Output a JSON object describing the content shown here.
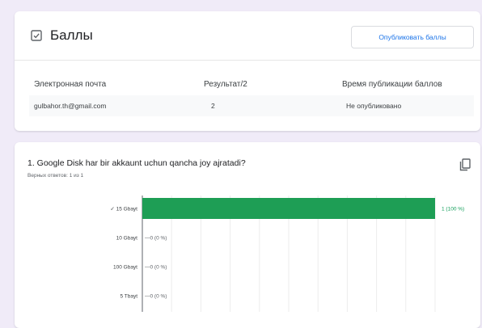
{
  "scores_card": {
    "title": "Баллы",
    "icon": "checkbox-icon",
    "publish_button": "Опубликовать баллы",
    "columns": [
      "Электронная почта",
      "Результат/2",
      "Время публикации баллов"
    ],
    "rows": [
      {
        "email": "gulbahor.th@gmail.com",
        "score": "2",
        "published": "Не опубликовано"
      }
    ]
  },
  "question_card": {
    "title": "1. Google Disk har bir akkaunt uchun qancha joy ajratadi?",
    "correct_count": "Верных ответов: 1 из 1",
    "copy_icon": "copy-icon"
  },
  "colors": {
    "accent_blue": "#1a73e8",
    "bar_green": "#1e9e55",
    "background": "#f0ebf8"
  },
  "chart_data": {
    "type": "bar",
    "orientation": "horizontal",
    "categories": [
      "✓ 15 Gbayt",
      "10 Gbayt",
      "100 Gbayt",
      "5 Tbayt"
    ],
    "values": [
      1,
      0,
      0,
      0
    ],
    "value_labels": [
      "1 (100 %)",
      "—0 (0 %)",
      "—0 (0 %)",
      "—0 (0 %)"
    ],
    "xlim": [
      0,
      1
    ],
    "grid": true
  }
}
